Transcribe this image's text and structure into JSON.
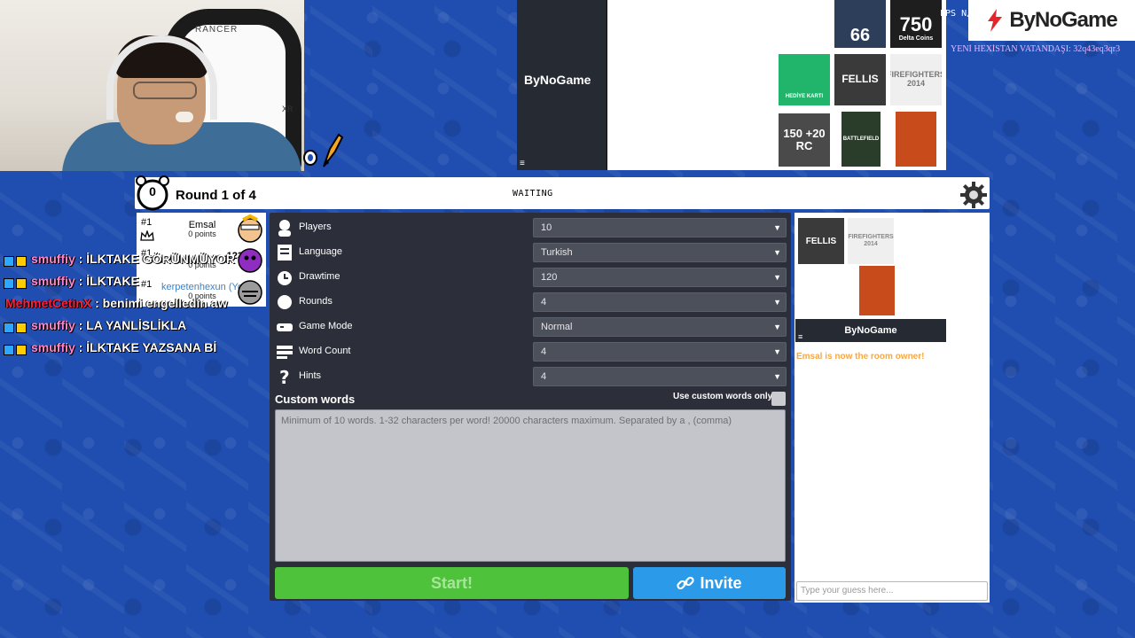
{
  "webcam": {
    "chair_brand": "RANCER",
    "chair_model": "XR"
  },
  "ads": {
    "mid_logo": "ByNoGame",
    "menu_glyph": "≡",
    "tiles": [
      {
        "id": "diamond",
        "label": "66",
        "color": "#2c3e5a"
      },
      {
        "id": "delta-coins",
        "label": "750",
        "sub": "Delta Coins",
        "color": "#1e1e1e"
      },
      {
        "id": "gift-card",
        "label": "HEDİYE KARTI",
        "color": "#21b46b"
      },
      {
        "id": "fellis",
        "label": "FELLIS",
        "color": "#3a3a3a"
      },
      {
        "id": "firefighters",
        "label": "FIREFIGHTERS 2014",
        "color": "#efefef"
      },
      {
        "id": "unturn",
        "label": "150 +20 RC",
        "color": "#4a4a4a"
      },
      {
        "id": "battlefield",
        "label": "BATTLEFIELD",
        "color": "#2a3d2a"
      },
      {
        "id": "borderlands",
        "label": "",
        "color": "#c84b1b"
      }
    ]
  },
  "brand": {
    "name": "ByNoGame",
    "fps": "FPS N/A"
  },
  "ticker": "YENİ HEXİSTAN VATANDAŞI: 32q43eq3qr3",
  "game": {
    "timer": "0",
    "round": "Round 1 of 4",
    "status": "WAITING",
    "players": [
      {
        "rank": "#1",
        "name": "Emsal",
        "points": "0 points",
        "name_color": "#000000"
      },
      {
        "rank": "#1",
        "name": "-123",
        "points": "0 points",
        "name_color": "#000000"
      },
      {
        "rank": "#1",
        "name": "kerpetenhexun (Yo",
        "points": "0 points",
        "name_color": "#3f82c4"
      }
    ]
  },
  "chat": [
    {
      "user": "smuffiy",
      "text": " : İLKTAKE GÖRÜNMÜYOR",
      "user_class": "u-smuf"
    },
    {
      "user": "smuffiy",
      "text": " : İLKTAKE",
      "user_class": "u-smuf"
    },
    {
      "user": "MehmetCetinX",
      "text": " : benimi engelledin aw",
      "user_class": "u-mehmet"
    },
    {
      "user": "smuffiy",
      "text": " : LA YANLİSLİKLA",
      "user_class": "u-smuf"
    },
    {
      "user": "smuffiy",
      "text": " : İLKTAKE YAZSANA Bİ",
      "user_class": "u-smuf"
    }
  ],
  "settings": {
    "rows": [
      {
        "label": "Players",
        "value": "10",
        "icon": "person-icon"
      },
      {
        "label": "Language",
        "value": "Turkish",
        "icon": "book-icon"
      },
      {
        "label": "Drawtime",
        "value": "120",
        "icon": "clock-icon"
      },
      {
        "label": "Rounds",
        "value": "4",
        "icon": "circle-icon"
      },
      {
        "label": "Game Mode",
        "value": "Normal",
        "icon": "gamepad-icon"
      },
      {
        "label": "Word Count",
        "value": "4",
        "icon": "word-icon"
      },
      {
        "label": "Hints",
        "value": "4",
        "icon": "question-icon"
      }
    ],
    "custom_words_title": "Custom words",
    "custom_words_only": "Use custom words only",
    "custom_words_placeholder": "Minimum of 10 words. 1-32 characters per word! 20000 characters maximum. Separated by a , (comma)",
    "start_label": "Start!",
    "invite_label": "Invite"
  },
  "right_panel": {
    "ad_logo": "ByNoGame",
    "ad_menu": "≡",
    "owner_message": "Emsal is now the room owner!",
    "guess_placeholder": "Type your guess here..."
  },
  "colors": {
    "accent_green": "#4dc23a",
    "accent_blue": "#2b9ae8",
    "owner_msg": "#f3a94b"
  }
}
